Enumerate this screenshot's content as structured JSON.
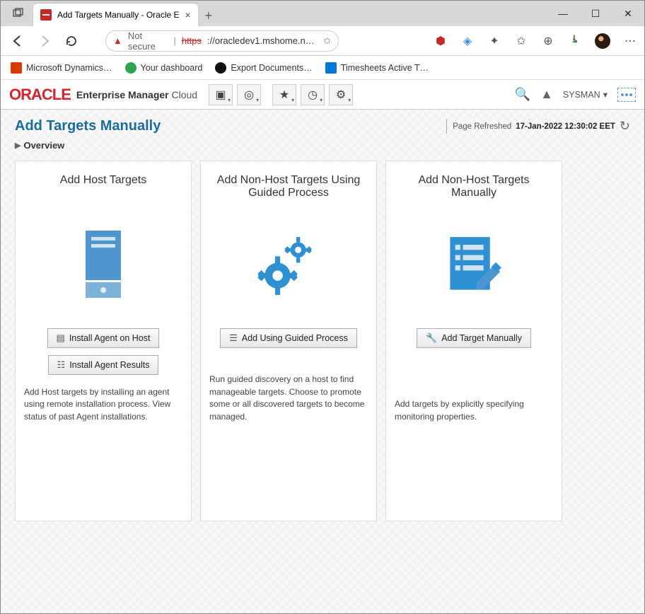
{
  "browser": {
    "tab_title": "Add Targets Manually - Oracle E",
    "url_not_secure": "Not secure",
    "url_proto": "https",
    "url_rest": "://oracledev1.mshome.net:7…",
    "bookmarks": [
      {
        "label": "Microsoft Dynamics…",
        "color": "#d83b01"
      },
      {
        "label": "Your dashboard",
        "color": "#2da44e"
      },
      {
        "label": "Export Documents…",
        "color": "#111"
      },
      {
        "label": "Timesheets Active T…",
        "color": "#0078d4"
      }
    ]
  },
  "app": {
    "brand_word": "ORACLE",
    "brand_em": "Enterprise Manager",
    "brand_suffix": " Cloud ",
    "user": "SYSMAN",
    "page_title": "Add Targets Manually",
    "refresh_label": "Page Refreshed",
    "refresh_time": "17-Jan-2022 12:30:02 EET",
    "overview": "Overview"
  },
  "cards": [
    {
      "title": "Add Host Targets",
      "buttons": [
        "Install Agent on Host",
        "Install Agent Results"
      ],
      "desc": "Add Host targets by installing an agent using remote installation process. View status of past Agent installations."
    },
    {
      "title": "Add Non-Host Targets Using Guided Process",
      "buttons": [
        "Add Using Guided Process"
      ],
      "desc": "Run guided discovery on a host to find manageable targets. Choose to promote some or all discovered targets to become managed."
    },
    {
      "title": "Add Non-Host Targets Manually",
      "buttons": [
        "Add Target Manually"
      ],
      "desc": "Add targets by explicitly specifying monitoring properties."
    }
  ]
}
